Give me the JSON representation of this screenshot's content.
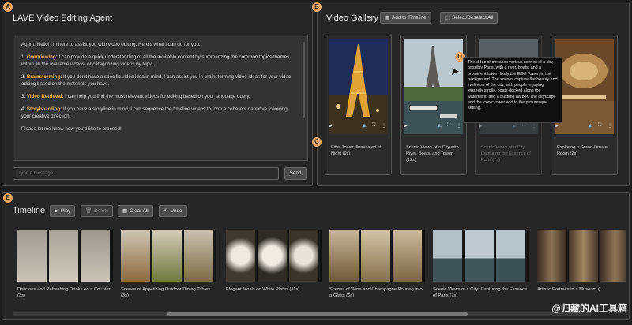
{
  "agent_panel": {
    "badge": "A",
    "title": "LAVE Video Editing Agent",
    "msg_intro": "Agent: Hello! I'm here to assist you with video editing. Here's what I can do for you:",
    "items": [
      {
        "num": "1.",
        "kw": "Overviewing:",
        "text": " I can provide a quick understanding of all the available content by summarizing the common topics/themes within all the available videos, or categorizing videos by topic."
      },
      {
        "num": "2.",
        "kw": "Brainstorming:",
        "text": " If you don't have a specific video idea in mind, I can assist you in brainstorming video ideas for your video editing based on the materials you have."
      },
      {
        "num": "3.",
        "kw": "Video Retrieval:",
        "text": " I can help you find the most relevant videos for editing based on your language query."
      },
      {
        "num": "4.",
        "kw": "Storyboarding:",
        "text": " If you have a storyline in mind, I can sequence the timeline videos to form a coherent narrative following your creative direction."
      }
    ],
    "msg_outro": "Please let me know how you'd like to proceed!",
    "input_placeholder": "Type a message...",
    "send_label": "Send"
  },
  "gallery": {
    "badge": "B",
    "title": "Video Gallery",
    "add_label": "Add to Timeline",
    "select_label": "Select/Deselect All",
    "card_badge": "C",
    "hover_badge": "D",
    "videos": [
      {
        "caption": "Eiffel Tower Illuminated at Night (9s)"
      },
      {
        "caption": "Scenic Views of a City with River, Boats, and Tower (12s)"
      },
      {
        "caption": "Scenic Views of a City Capturing the Essence of Paris (7s)"
      },
      {
        "caption": "Exploring a Grand Ornate Room (2s)"
      }
    ],
    "tooltip": "The video showcases various scenes of a city, possibly Paris, with a river, boats, and a prominent tower, likely the Eiffel Tower, in the background. The scenes capture the beauty and liveliness of the city, with people enjoying leisurely strolls, boats docked along the waterfront, and a bustling harbor. The cityscape and the iconic tower add to the picturesque setting."
  },
  "timeline": {
    "badge": "E",
    "title": "Timeline",
    "play_label": "Play",
    "delete_label": "Delete",
    "clear_label": "Clear All",
    "undo_label": "Undo",
    "items": [
      {
        "caption": "Delicious and Refreshing Drinks on a Counter (3s)"
      },
      {
        "caption": "Scenes of Appetizing Outdoor Dining Tables (3s)"
      },
      {
        "caption": "Elegant Meals on White Plates (11s)"
      },
      {
        "caption": "Scenes of Wine and Champagne Pouring into a Glass (6s)"
      },
      {
        "caption": "Scenic Views of a City: Capturing the Essence of Paris (7s)"
      },
      {
        "caption": "Artistic Portraits in a Museum (…"
      }
    ]
  },
  "watermark": "@归藏的AI工具箱",
  "icons": {
    "play": "play-icon",
    "volume": "volume-icon",
    "fullscreen": "fullscreen-icon",
    "more": "more-icon",
    "cursor": "cursor-arrow-icon"
  }
}
